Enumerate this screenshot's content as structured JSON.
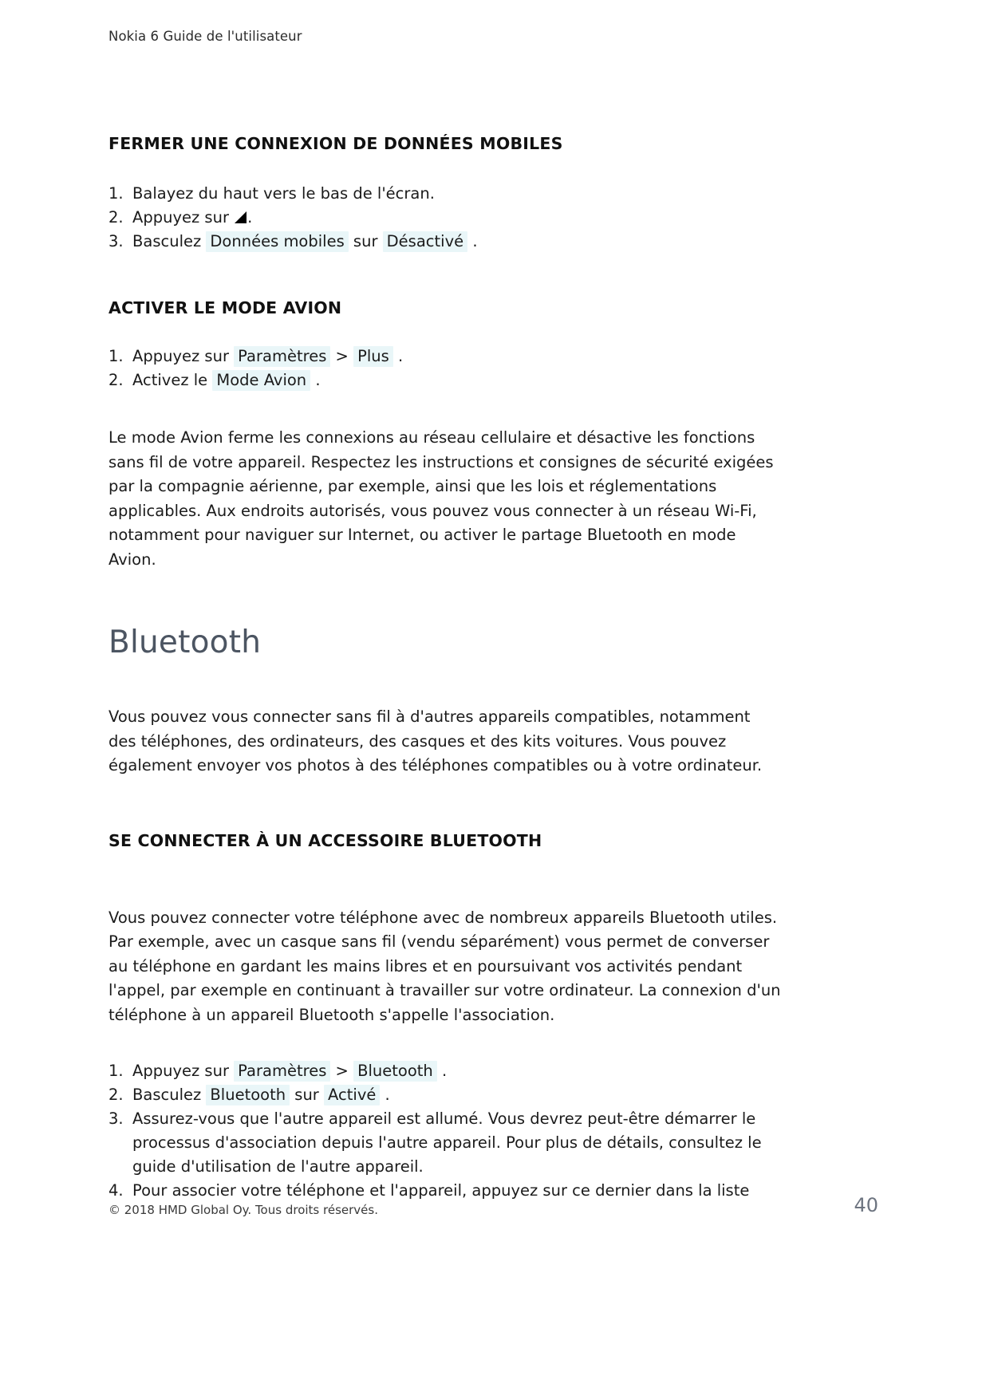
{
  "document": {
    "running_head": "Nokia 6 Guide de l'utilisateur",
    "page_number": "40",
    "copyright": "© 2018 HMD Global Oy. Tous droits réservés.",
    "heading_color": "#4c5562",
    "ui_chip_background": "#e9f6f8"
  },
  "section_close_mobile_data": {
    "heading": "FERMER UNE CONNEXION DE DONNÉES MOBILES",
    "steps": [
      {
        "num": "1.",
        "parts": [
          {
            "type": "text",
            "value": "Balayez du haut vers le bas de l'écran."
          }
        ]
      },
      {
        "num": "2.",
        "parts": [
          {
            "type": "text",
            "value": "Appuyez sur "
          },
          {
            "type": "icon",
            "value": "triangle-icon"
          },
          {
            "type": "text",
            "value": "."
          }
        ]
      },
      {
        "num": "3.",
        "parts": [
          {
            "type": "text",
            "value": "Basculez "
          },
          {
            "type": "ui",
            "value": "Données mobiles"
          },
          {
            "type": "text",
            "value": " sur "
          },
          {
            "type": "ui",
            "value": "Désactivé"
          },
          {
            "type": "text",
            "value": " ."
          }
        ]
      }
    ]
  },
  "section_airplane_mode": {
    "heading": "ACTIVER LE MODE AVION",
    "steps": [
      {
        "num": "1.",
        "parts": [
          {
            "type": "text",
            "value": "Appuyez sur "
          },
          {
            "type": "ui",
            "value": "Paramètres"
          },
          {
            "type": "text",
            "value": " > "
          },
          {
            "type": "ui",
            "value": "Plus"
          },
          {
            "type": "text",
            "value": " ."
          }
        ]
      },
      {
        "num": "2.",
        "parts": [
          {
            "type": "text",
            "value": "Activez le "
          },
          {
            "type": "ui",
            "value": "Mode Avion"
          },
          {
            "type": "text",
            "value": " ."
          }
        ]
      }
    ],
    "paragraph": "Le mode Avion ferme les connexions au réseau cellulaire et désactive les fonctions sans fil de votre appareil. Respectez les instructions et consignes de sécurité exigées par la compagnie aérienne, par exemple, ainsi que les lois et réglementations applicables. Aux endroits autorisés, vous pouvez vous connecter à un réseau Wi-Fi, notamment pour naviguer sur Internet, ou activer le partage Bluetooth en mode Avion."
  },
  "section_bluetooth": {
    "heading": "Bluetooth",
    "intro": "Vous pouvez vous connecter sans fil à d'autres appareils compatibles, notamment des téléphones, des ordinateurs, des casques et des kits voitures. Vous pouvez également envoyer vos photos à des téléphones compatibles ou à votre ordinateur.",
    "subheading": "SE CONNECTER À UN ACCESSOIRE BLUETOOTH",
    "paragraph": "Vous pouvez connecter votre téléphone avec de nombreux appareils Bluetooth utiles. Par exemple, avec un casque sans fil (vendu séparément) vous permet de converser au téléphone en gardant les mains libres et en poursuivant vos activités pendant l'appel, par exemple en continuant à travailler sur votre ordinateur. La connexion d'un téléphone à un appareil Bluetooth s'appelle l'association.",
    "steps": [
      {
        "num": "1.",
        "parts": [
          {
            "type": "text",
            "value": "Appuyez sur "
          },
          {
            "type": "ui",
            "value": "Paramètres"
          },
          {
            "type": "text",
            "value": " > "
          },
          {
            "type": "ui",
            "value": "Bluetooth"
          },
          {
            "type": "text",
            "value": " ."
          }
        ]
      },
      {
        "num": "2.",
        "parts": [
          {
            "type": "text",
            "value": "Basculez "
          },
          {
            "type": "ui",
            "value": "Bluetooth"
          },
          {
            "type": "text",
            "value": " sur "
          },
          {
            "type": "ui",
            "value": "Activé"
          },
          {
            "type": "text",
            "value": " ."
          }
        ]
      },
      {
        "num": "3.",
        "parts": [
          {
            "type": "text",
            "value": "Assurez-vous que l'autre appareil est allumé. Vous devrez peut-être démarrer le processus d'association depuis l'autre appareil. Pour plus de détails, consultez le guide d'utilisation de l'autre appareil."
          }
        ]
      },
      {
        "num": "4.",
        "parts": [
          {
            "type": "text",
            "value": "Pour associer votre téléphone et l'appareil, appuyez sur ce dernier dans la liste"
          }
        ]
      }
    ]
  }
}
